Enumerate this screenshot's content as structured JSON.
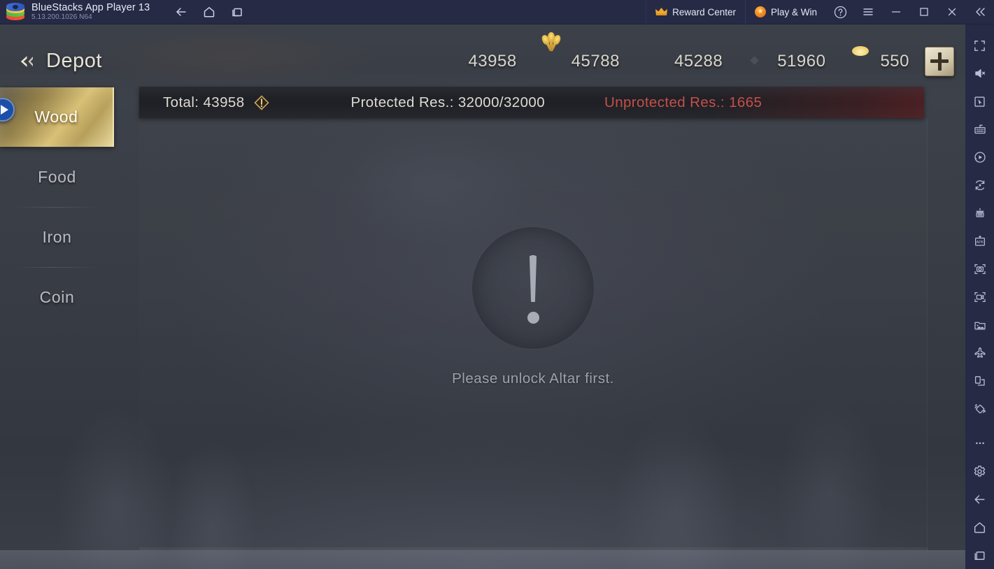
{
  "titlebar": {
    "app_name": "BlueStacks App Player 13",
    "version": "5.13.200.1026  N64",
    "logo_icon": "bluestacks-logo",
    "nav": [
      {
        "name": "back",
        "icon": "arrow-left-icon",
        "label": "Back"
      },
      {
        "name": "home",
        "icon": "home-icon",
        "label": "Home"
      },
      {
        "name": "recents",
        "icon": "recents-icon",
        "label": "Recent apps"
      }
    ],
    "reward_center": {
      "label": "Reward Center",
      "icon": "crown-icon"
    },
    "play_and_win": {
      "label": "Play & Win",
      "icon": "star-badge-icon"
    },
    "help": {
      "icon": "help-circle-icon",
      "label": "?"
    },
    "menu": {
      "icon": "hamburger-menu-icon"
    },
    "minimize": {
      "icon": "minimize-icon"
    },
    "maximize": {
      "icon": "maximize-icon"
    },
    "close": {
      "icon": "close-icon"
    },
    "collapse_sidebar": {
      "icon": "chevron-double-left-icon"
    }
  },
  "toolbar": {
    "items": [
      {
        "name": "fullscreen",
        "icon": "fullscreen-icon"
      },
      {
        "name": "mute",
        "icon": "speaker-mute-icon"
      },
      {
        "name": "controls",
        "icon": "cursor-pointer-icon"
      },
      {
        "name": "keyboard-controls",
        "icon": "keyboard-icon"
      },
      {
        "name": "macro-play",
        "icon": "macro-record-icon"
      },
      {
        "name": "sync-operations",
        "icon": "sync-rotate-icon"
      },
      {
        "name": "game-controls",
        "icon": "game-controls-icon"
      },
      {
        "name": "install-apk",
        "icon": "apk-install-icon"
      },
      {
        "name": "screenshot",
        "icon": "camera-icon"
      },
      {
        "name": "record-screen",
        "icon": "video-record-icon"
      },
      {
        "name": "media-manager",
        "icon": "media-gallery-icon"
      },
      {
        "name": "airplane-mode",
        "icon": "airplane-icon"
      },
      {
        "name": "multi-instance",
        "icon": "multi-instance-icon"
      },
      {
        "name": "shake",
        "icon": "shake-tilt-icon"
      },
      {
        "name": "more",
        "icon": "ellipsis-icon"
      },
      {
        "name": "settings",
        "icon": "gear-icon"
      },
      {
        "name": "android-back",
        "icon": "arrow-left-icon"
      },
      {
        "name": "android-home",
        "icon": "home-icon"
      },
      {
        "name": "android-recents",
        "icon": "recents-icon"
      }
    ]
  },
  "game": {
    "header": {
      "back_icon": "double-chevron-left-icon",
      "title": "Depot",
      "resources": [
        {
          "name": "wood",
          "icon": "wood-log-icon",
          "value": "43958"
        },
        {
          "name": "food",
          "icon": "wheat-icon",
          "value": "45788"
        },
        {
          "name": "iron",
          "icon": "iron-ingot-icon",
          "value": "45288"
        },
        {
          "name": "coin",
          "icon": "silver-coin-icon",
          "value": "51960"
        },
        {
          "name": "gold",
          "icon": "gold-ingot-icon",
          "value": "550"
        }
      ],
      "add_button": {
        "icon": "plus-icon",
        "label": "+"
      }
    },
    "side_tabs": [
      {
        "name": "wood",
        "label": "Wood",
        "active": true
      },
      {
        "name": "food",
        "label": "Food",
        "active": false
      },
      {
        "name": "iron",
        "label": "Iron",
        "active": false
      },
      {
        "name": "coin",
        "label": "Coin",
        "active": false
      }
    ],
    "collapse_button": {
      "icon": "play-triangle-icon"
    },
    "info_bar": {
      "total_label": "Total: 43958",
      "warn_icon": "warning-diamond-icon",
      "protected_label": "Protected Res.: 32000/32000",
      "unprotected_label": "Unprotected Res.: 1665",
      "unprotected_color": "#c4504b"
    },
    "empty_state": {
      "icon": "exclamation-circle-icon",
      "message": "Please unlock Altar first."
    }
  }
}
